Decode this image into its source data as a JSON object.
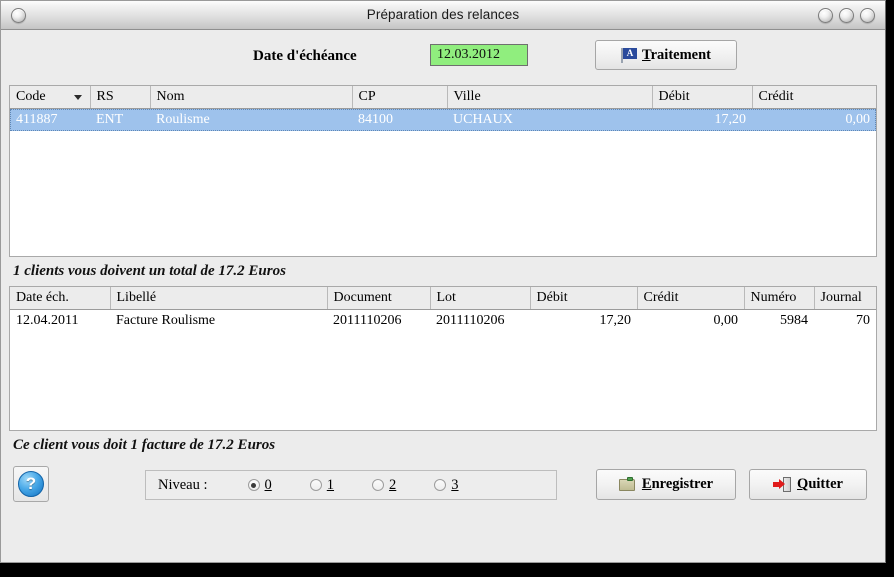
{
  "window": {
    "title": "Préparation des relances",
    "buttons": {
      "left_icon": "app-menu-icon",
      "minimize": "minimize-icon",
      "maximize": "maximize-icon",
      "close": "close-icon"
    }
  },
  "toolbar": {
    "date_label": "Date d'échéance",
    "date_value": "12.03.2012",
    "date_field_color": "#90ee7e",
    "traitement_button": {
      "icon": "flag-a-icon",
      "icon_letter": "A",
      "mnemonic": "T",
      "label_rest": "raitement"
    }
  },
  "clients_table": {
    "columns": [
      {
        "label": "Code",
        "sorted": true,
        "align": "left"
      },
      {
        "label": "RS",
        "sorted": false,
        "align": "left"
      },
      {
        "label": "Nom",
        "sorted": false,
        "align": "left"
      },
      {
        "label": "CP",
        "sorted": false,
        "align": "left"
      },
      {
        "label": "Ville",
        "sorted": false,
        "align": "left"
      },
      {
        "label": "Débit",
        "sorted": false,
        "align": "right"
      },
      {
        "label": "Crédit",
        "sorted": false,
        "align": "right"
      }
    ],
    "rows": [
      {
        "selected": true,
        "code": "411887",
        "rs": "ENT",
        "nom": "Roulisme",
        "cp": "84100",
        "ville": "UCHAUX",
        "debit": "17,20",
        "credit": "0,00"
      }
    ],
    "selection_color": "#9ec2ec"
  },
  "clients_summary": "1 clients vous doivent un total de 17.2 Euros",
  "invoices_table": {
    "columns": [
      {
        "label": "Date éch.",
        "align": "left"
      },
      {
        "label": "Libellé",
        "align": "left"
      },
      {
        "label": "Document",
        "align": "left"
      },
      {
        "label": "Lot",
        "align": "left"
      },
      {
        "label": "Débit",
        "align": "right"
      },
      {
        "label": "Crédit",
        "align": "right"
      },
      {
        "label": "Numéro",
        "align": "right"
      },
      {
        "label": "Journal",
        "align": "right"
      }
    ],
    "rows": [
      {
        "selected": false,
        "date_ech": "12.04.2011",
        "libelle": "Facture Roulisme",
        "document": "2011110206",
        "lot": "2011110206",
        "debit": "17,20",
        "credit": "0,00",
        "numero": "5984",
        "journal": "70"
      }
    ]
  },
  "invoice_summary": "Ce client vous doit 1 facture de 17.2 Euros",
  "bottom_bar": {
    "help_icon": "help-question-icon",
    "help_glyph": "?",
    "niveau_label": "Niveau :",
    "niveau_options": [
      {
        "label": "0",
        "selected": true
      },
      {
        "label": "1",
        "selected": false
      },
      {
        "label": "2",
        "selected": false
      },
      {
        "label": "3",
        "selected": false
      }
    ],
    "enregistrer_button": {
      "icon": "save-folder-icon",
      "mnemonic": "E",
      "label_rest": "nregistrer"
    },
    "quitter_button": {
      "icon": "exit-door-icon",
      "mnemonic": "Q",
      "label_rest": "uitter"
    }
  }
}
